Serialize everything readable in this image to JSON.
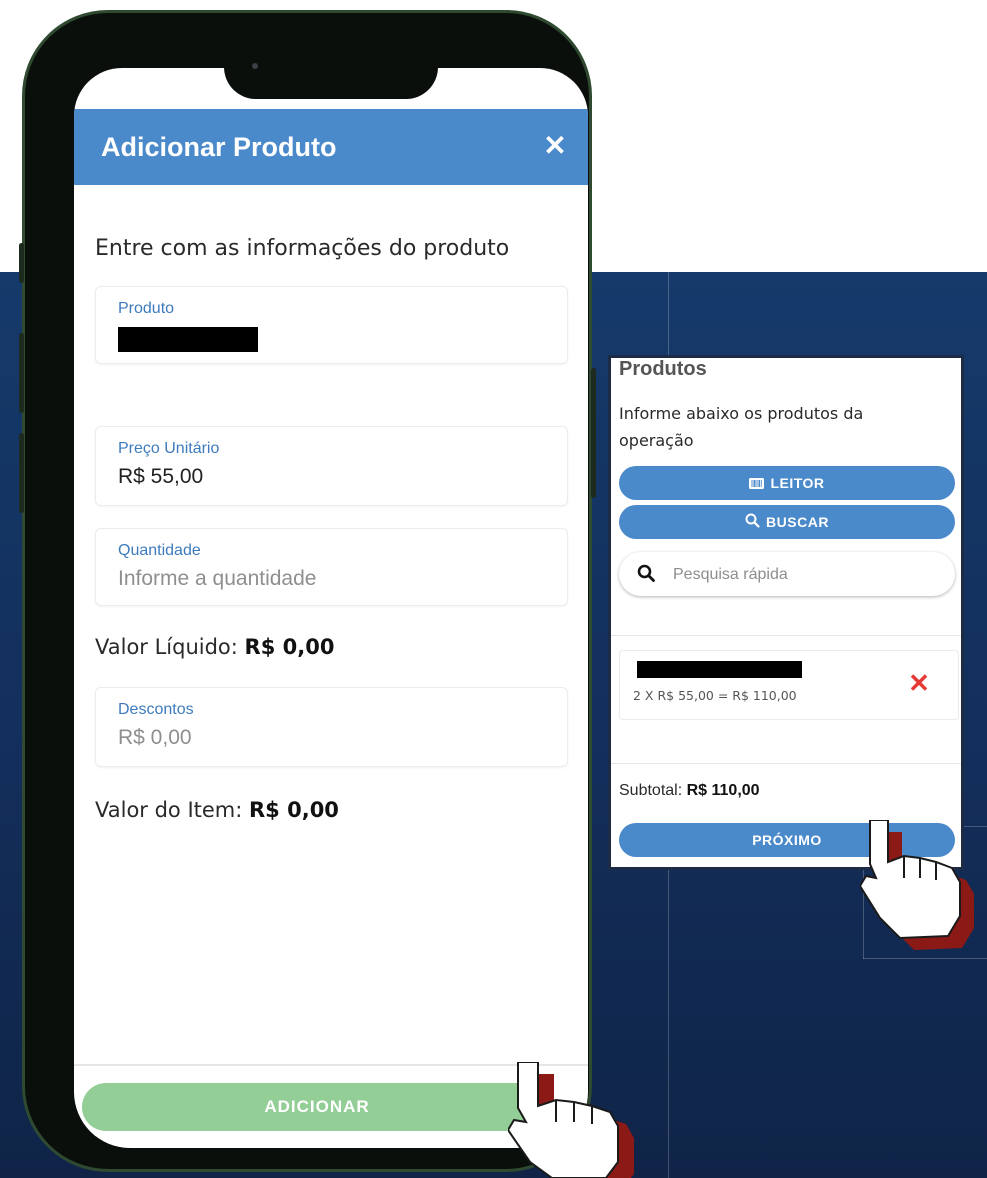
{
  "phone_modal": {
    "title": "Adicionar Produto",
    "close_icon": "close-icon",
    "subtitle": "Entre com as informações do produto",
    "fields": {
      "produto": {
        "label": "Produto",
        "value": ""
      },
      "preco": {
        "label": "Preço Unitário",
        "value": "R$ 55,00"
      },
      "quantidade": {
        "label": "Quantidade",
        "placeholder": "Informe a quantidade"
      },
      "descontos": {
        "label": "Descontos",
        "placeholder": "R$ 0,00"
      }
    },
    "valor_liquido": {
      "label": "Valor Líquido: ",
      "value": "R$ 0,00"
    },
    "valor_item": {
      "label": "Valor do Item: ",
      "value": "R$ 0,00"
    },
    "add_button": "ADICIONAR"
  },
  "products_card": {
    "title": "Produtos",
    "description": "Informe abaixo os produtos da operação",
    "leitor_button": "LEITOR",
    "buscar_button": "BUSCAR",
    "search_placeholder": "Pesquisa rápida",
    "item": {
      "line": "2 X R$ 55,00 = R$ 110,00"
    },
    "subtotal_label": "Subtotal: ",
    "subtotal_value": "R$ 110,00",
    "next_button": "PRÓXIMO"
  },
  "colors": {
    "primary": "#4a89ca",
    "add_button_disabled": "#93ce97",
    "remove": "#e53935",
    "background": "#132e5a"
  }
}
